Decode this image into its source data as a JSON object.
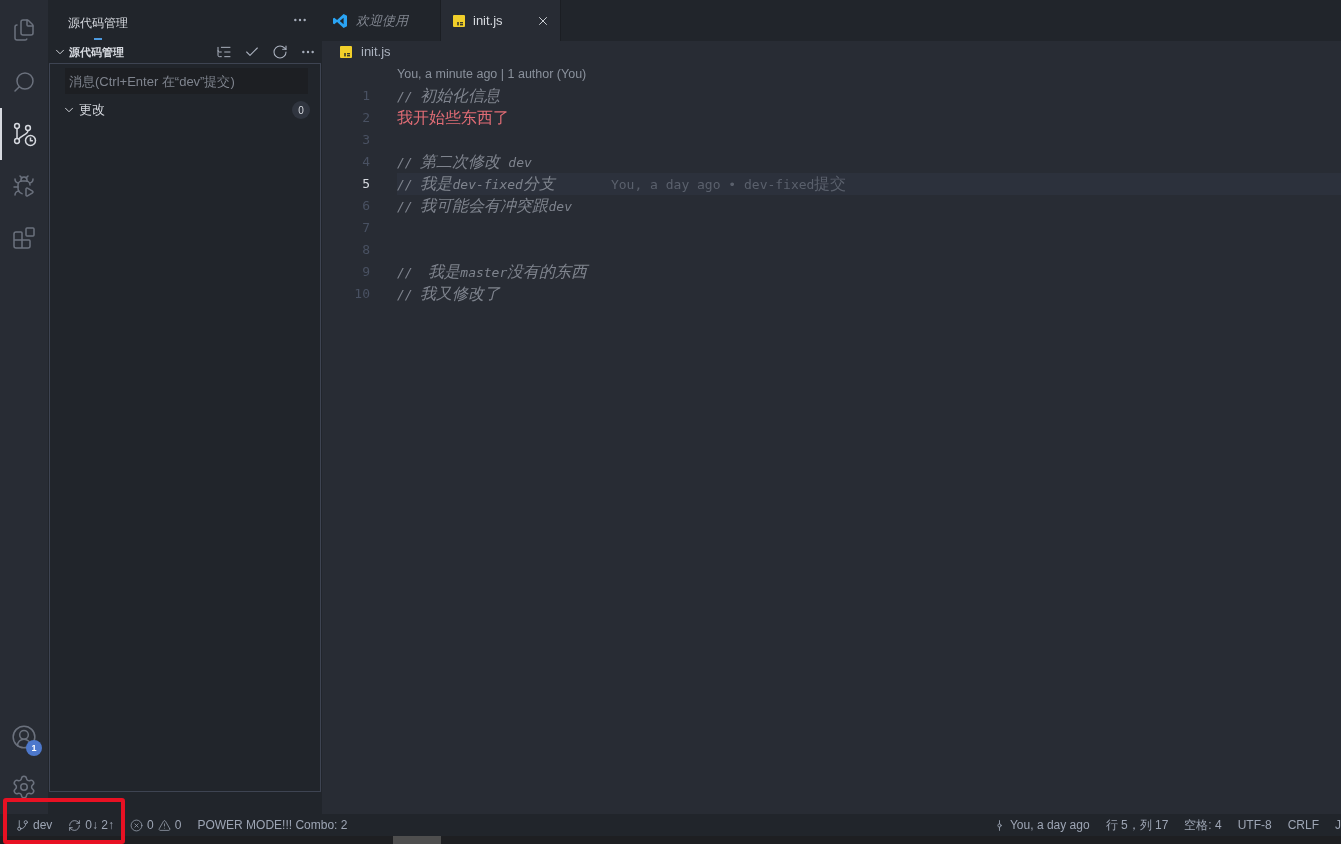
{
  "activity_bar": {
    "items": [
      {
        "kind": "explorer",
        "selected": false
      },
      {
        "kind": "search",
        "selected": false
      },
      {
        "kind": "source_control",
        "selected": true
      },
      {
        "kind": "run_debug",
        "selected": false
      },
      {
        "kind": "extensions",
        "selected": false
      }
    ],
    "bottom_items": [
      {
        "kind": "accounts",
        "badge": "1"
      },
      {
        "kind": "settings"
      }
    ]
  },
  "sidebar": {
    "title": "源代码管理",
    "section": {
      "title": "源代码管理",
      "expanded": true
    },
    "message_input": {
      "placeholder": "消息(Ctrl+Enter 在“dev”提交)"
    },
    "changes": {
      "label": "更改",
      "count": "0",
      "expanded": true
    }
  },
  "tabs": [
    {
      "label": "欢迎使用",
      "kind": "welcome",
      "selected": false,
      "preview": true
    },
    {
      "label": "init.js",
      "kind": "js",
      "selected": true,
      "preview": false
    }
  ],
  "breadcrumb": {
    "file": "init.js",
    "kind": "js"
  },
  "editor": {
    "codelens": "You, a minute ago | 1 author (You)",
    "lines": [
      {
        "number": "1",
        "text": "// 初始化信息",
        "kind": "comment",
        "current": false
      },
      {
        "number": "2",
        "text": "我开始些东西了",
        "kind": "invalid",
        "current": false
      },
      {
        "number": "3",
        "current": false
      },
      {
        "number": "4",
        "text": "// 第二次修改 dev",
        "kind": "comment",
        "current": false
      },
      {
        "number": "5",
        "text": "// 我是dev-fixed分支",
        "kind": "comment",
        "current": true,
        "blame": "You, a day ago • dev-fixed提交"
      },
      {
        "number": "6",
        "text": "// 我可能会有冲突跟dev",
        "kind": "comment",
        "current": false
      },
      {
        "number": "7",
        "current": false
      },
      {
        "number": "8",
        "current": false
      },
      {
        "number": "9",
        "text": "//  我是master没有的东西",
        "kind": "comment",
        "current": false
      },
      {
        "number": "10",
        "text": "// 我又修改了",
        "kind": "comment",
        "current": false
      }
    ]
  },
  "status_bar": {
    "left": [
      {
        "kind": "branch",
        "text": "dev",
        "highlighted": true
      },
      {
        "kind": "sync",
        "text": "0↓ 2↑",
        "highlighted": true
      },
      {
        "kind": "problems",
        "errors": "0",
        "warnings": "0",
        "highlighted": false
      },
      {
        "kind": "text",
        "text": "POWER MODE!!! Combo: 2",
        "highlighted": false
      }
    ],
    "right": [
      {
        "kind": "blame",
        "text": "You, a day ago"
      },
      {
        "kind": "text",
        "text": "行 5，列 17"
      },
      {
        "kind": "text",
        "text": "空格: 4"
      },
      {
        "kind": "text",
        "text": "UTF-8"
      },
      {
        "kind": "text",
        "text": "CRLF"
      },
      {
        "kind": "text",
        "text": "J"
      }
    ]
  }
}
